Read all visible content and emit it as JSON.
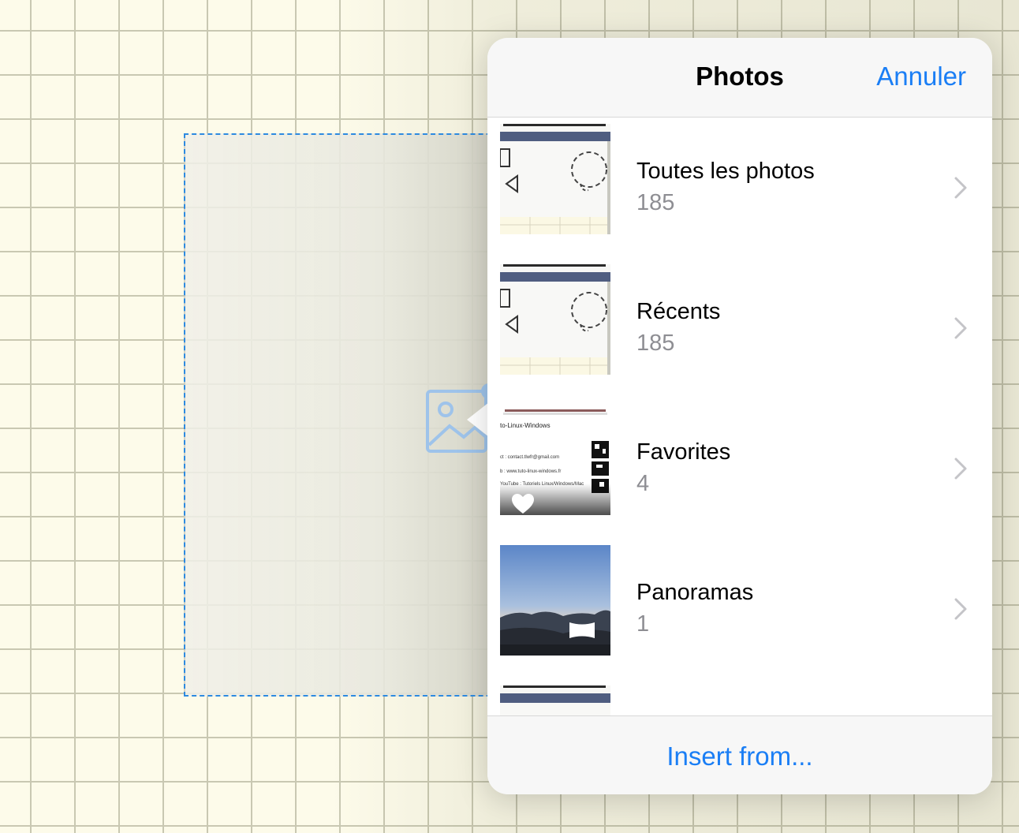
{
  "popover": {
    "title": "Photos",
    "cancel_label": "Annuler",
    "footer_label": "Insert from..."
  },
  "albums": [
    {
      "title": "Toutes les photos",
      "count": "185"
    },
    {
      "title": "Récents",
      "count": "185"
    },
    {
      "title": "Favorites",
      "count": "4"
    },
    {
      "title": "Panoramas",
      "count": "1"
    }
  ],
  "thumb_text": {
    "t3_line1": "to-Linux-Windows",
    "t3_line2": "ct : contact.tlwfr@gmail.com",
    "t3_line3": "b : www.tuto-linux-windows.fr",
    "t3_line4": "YouTube : Tutoriels Linux/Windows/Mac"
  },
  "colors": {
    "accent": "#1a7ef5",
    "secondary_text": "#8e8e93",
    "frame": "#2d8ae0"
  },
  "icons": {
    "placeholder": "image-placeholder-icon",
    "chevron": "chevron-right-icon",
    "favorite": "heart-icon",
    "panorama": "panorama-icon"
  }
}
